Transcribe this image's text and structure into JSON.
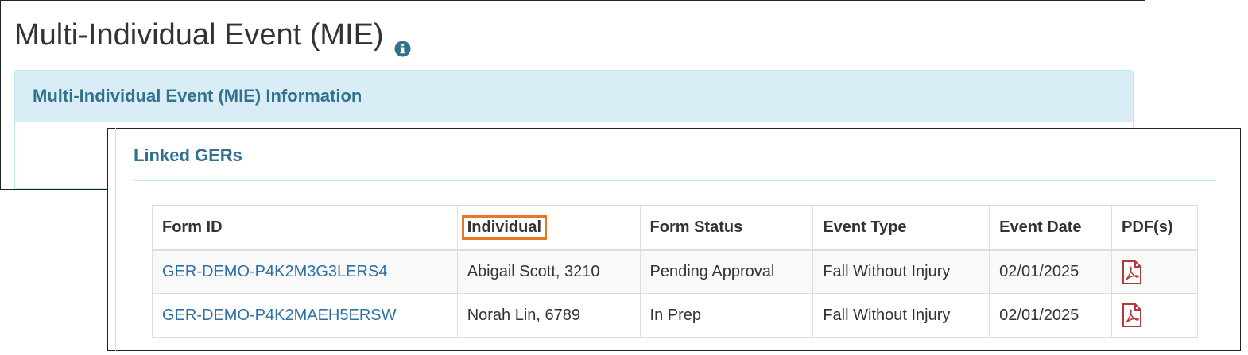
{
  "page": {
    "title": "Multi-Individual Event (MIE)",
    "info_icon": "info-circle-icon"
  },
  "mie_panel": {
    "heading": "Multi-Individual Event (MIE) Information"
  },
  "linked_gers": {
    "heading": "Linked GERs",
    "columns": [
      "Form ID",
      "Individual",
      "Form Status",
      "Event Type",
      "Event Date",
      "PDF(s)"
    ],
    "highlighted_column": "Individual",
    "highlight_color": "#e87722",
    "link_color": "#2f6fa5",
    "pdf_icon": "file-pdf-icon",
    "pdf_icon_color": "#b33a3a",
    "rows": [
      {
        "form_id": "GER-DEMO-P4K2M3G3LERS4",
        "individual": "Abigail Scott, 3210",
        "form_status": "Pending Approval",
        "event_type": "Fall Without Injury",
        "event_date": "02/01/2025"
      },
      {
        "form_id": "GER-DEMO-P4K2MAEH5ERSW",
        "individual": "Norah Lin, 6789",
        "form_status": "In Prep",
        "event_type": "Fall Without Injury",
        "event_date": "02/01/2025"
      }
    ]
  }
}
